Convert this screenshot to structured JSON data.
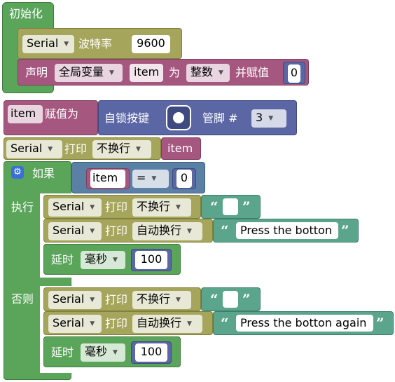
{
  "setup": {
    "title": "初始化",
    "serial_dd": "Serial",
    "baud_label": "波特率",
    "baud_value": "9600",
    "declare_label": "声明",
    "scope_dd": "全局变量",
    "var_name": "item",
    "as_label": "为",
    "type_dd": "整数",
    "assign_label": "并赋值",
    "init_value": "0"
  },
  "assign": {
    "var_dd": "item",
    "label": "赋值为",
    "button_label": "自锁按键",
    "pin_label": "管脚 #",
    "pin_dd": "3"
  },
  "print1": {
    "serial_dd": "Serial",
    "print_label": "打印",
    "mode_dd": "不换行",
    "value_var": "item"
  },
  "if_block": {
    "if_label": "如果",
    "var": "item",
    "op_dd": "=",
    "compare_value": "0",
    "then_label": "执行",
    "else_label": "否则"
  },
  "then": {
    "p1_serial": "Serial",
    "p1_print": "打印",
    "p1_mode": "不换行",
    "p1_text": "",
    "p2_serial": "Serial",
    "p2_print": "打印",
    "p2_mode": "自动换行",
    "p2_text": "Press the botton",
    "delay_label": "延时",
    "delay_unit": "毫秒",
    "delay_value": "100"
  },
  "else": {
    "p1_serial": "Serial",
    "p1_print": "打印",
    "p1_mode": "不换行",
    "p1_text": "",
    "p2_serial": "Serial",
    "p2_print": "打印",
    "p2_mode": "自动换行",
    "p2_text": "Press the botton again",
    "delay_label": "延时",
    "delay_unit": "毫秒",
    "delay_value": "100"
  },
  "quote_open": "“",
  "quote_close": "”",
  "arrow": "▼",
  "colors": {
    "setup": "#5ba55b",
    "serial": "#a5a55b",
    "variable": "#a5577f",
    "input": "#5b67a5",
    "logic": "#5b80a5",
    "text": "#5ba58c"
  }
}
